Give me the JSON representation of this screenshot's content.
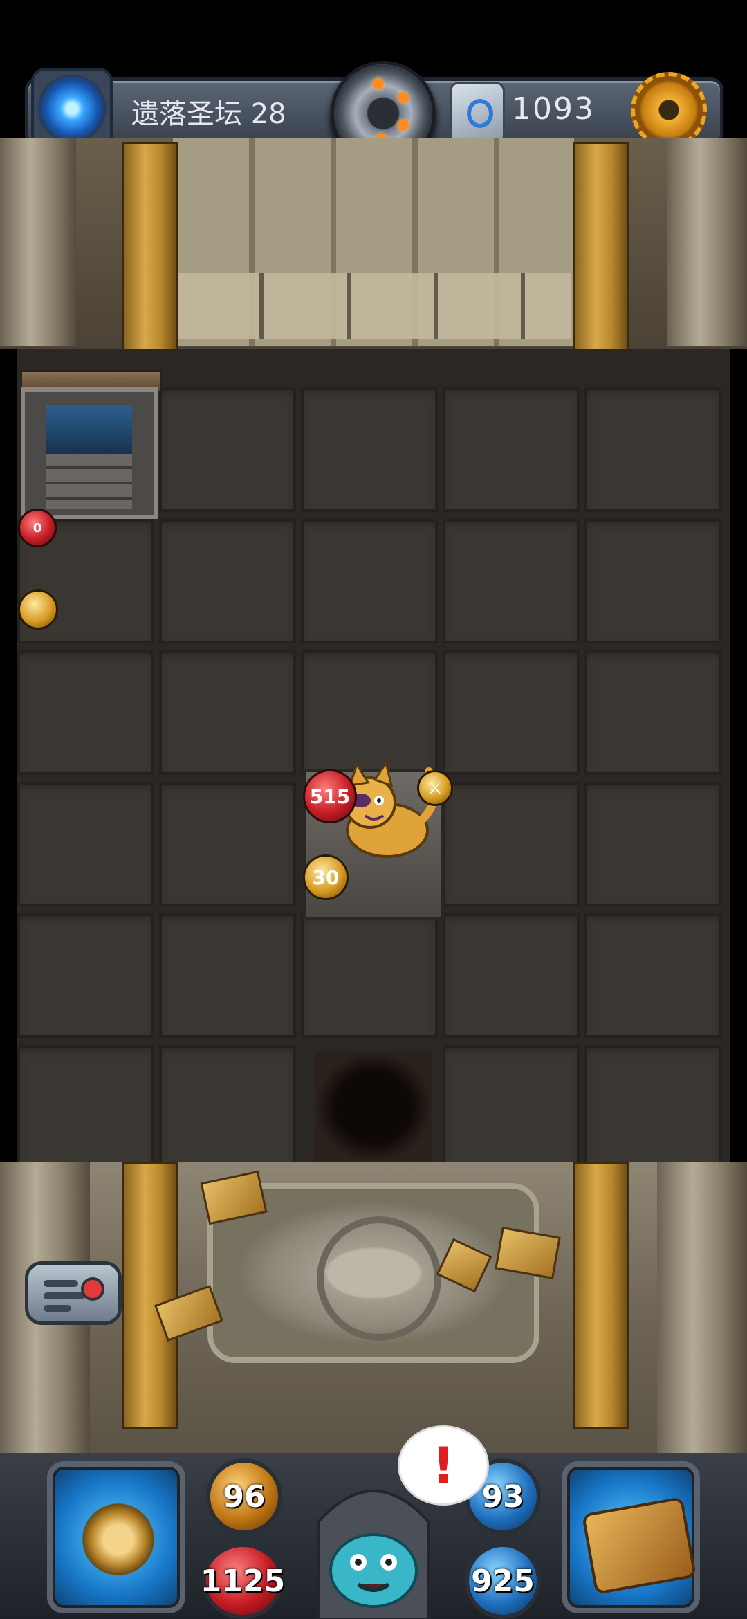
{
  "top_bar": {
    "floor_title": "遗落圣坛 28层",
    "currency_value": "1093",
    "icons": [
      "portal-icon",
      "bomb-wheel-icon",
      "rune-stone-icon",
      "gear-icon"
    ]
  },
  "board": {
    "item_red_orb_value": "0",
    "enemy": {
      "hp": "515",
      "attack": "30",
      "badge": "sword-badge-icon"
    }
  },
  "hud": {
    "attack": "96",
    "hp": "1125",
    "defense": "93",
    "mana": "925",
    "alert": "!"
  },
  "colors": {
    "gold": "#d69b22",
    "red": "#c41d24",
    "blue": "#1f6fbf"
  }
}
